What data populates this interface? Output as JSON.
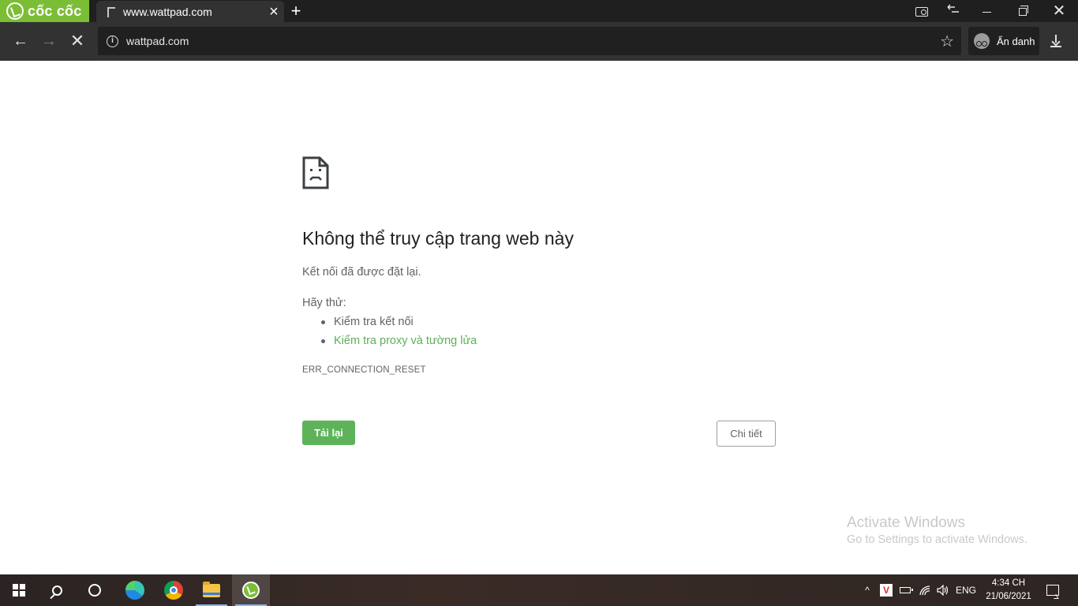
{
  "browser": {
    "brand_name": "cốc cốc",
    "tab": {
      "title": "www.wattpad.com",
      "close_glyph": "×"
    },
    "new_tab_glyph": "+",
    "window_controls": {
      "close_glyph": "✕"
    },
    "nav": {
      "back_glyph": "←",
      "forward_glyph": "→",
      "stop_glyph": "✕"
    },
    "omnibox": {
      "url": "wattpad.com",
      "info_glyph": "i",
      "star_glyph": "☆"
    },
    "incognito": {
      "label": "Ẩn danh"
    },
    "icons": [
      "info-icon",
      "star-icon",
      "incognito-icon",
      "download-icon",
      "search-tabs-icon",
      "back-tabs-icon",
      "minimize-icon",
      "restore-icon",
      "close-icon"
    ]
  },
  "error_page": {
    "title": "Không thể truy cập trang web này",
    "description": "Kết nối đã được đặt lại.",
    "try_label": "Hãy thử:",
    "suggestions": [
      {
        "text": "Kiểm tra kết nối",
        "is_link": false
      },
      {
        "text": "Kiểm tra proxy và tường lửa",
        "is_link": true
      }
    ],
    "error_code": "ERR_CONNECTION_RESET",
    "reload_label": "Tải lại",
    "details_label": "Chi tiết",
    "accent_color": "#5eb35a"
  },
  "watermark": {
    "title": "Activate Windows",
    "subtitle": "Go to Settings to activate Windows."
  },
  "taskbar": {
    "tray": {
      "overflow_glyph": "^",
      "antivirus_glyph": "V",
      "wifi_glyph": "◜",
      "volume_glyph": "🔈",
      "language": "ENG",
      "time": "4:34 CH",
      "date": "21/06/2021"
    }
  }
}
